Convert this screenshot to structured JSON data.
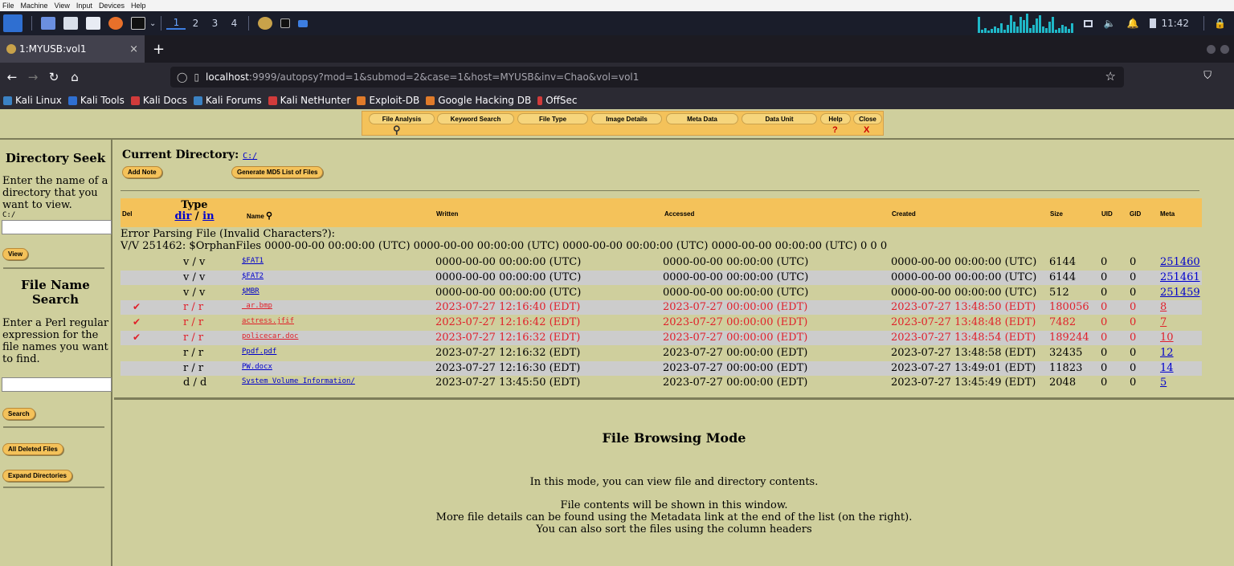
{
  "vm_menu": [
    "File",
    "Machine",
    "View",
    "Input",
    "Devices",
    "Help"
  ],
  "taskbar": {
    "workspaces": [
      "1",
      "2",
      "3",
      "4"
    ],
    "active_workspace": "1",
    "clock": "11:42",
    "accent": "#3d7ee0"
  },
  "browser": {
    "tab_title": "1:MYUSB:vol1",
    "tab_close": "×",
    "new_tab": "+",
    "url_host": "localhost",
    "url_rest": ":9999/autopsy?mod=1&submod=2&case=1&host=MYUSB&inv=Chao&vol=vol1",
    "bookmarks": [
      {
        "label": "Kali Linux",
        "color": "#3b82c4"
      },
      {
        "label": "Kali Tools",
        "color": "#2f6fd1"
      },
      {
        "label": "Kali Docs",
        "color": "#d13b3b"
      },
      {
        "label": "Kali Forums",
        "color": "#3b82c4"
      },
      {
        "label": "Kali NetHunter",
        "color": "#d13b3b"
      },
      {
        "label": "Exploit-DB",
        "color": "#e07b2a"
      },
      {
        "label": "Google Hacking DB",
        "color": "#e07b2a"
      },
      {
        "label": "OffSec",
        "color": "#d13b3b"
      }
    ]
  },
  "autopsy_toolbar": {
    "tabs": [
      "File Analysis",
      "Keyword Search",
      "File Type",
      "Image Details",
      "Meta Data",
      "Data Unit",
      "Help",
      "Close"
    ],
    "help_glyph": "?",
    "close_glyph": "X"
  },
  "left_panel": {
    "dir_seek_title": "Directory Seek",
    "dir_seek_text": "Enter the name of a directory that you want to view.",
    "dir_seek_example": "C:/",
    "view_button": "View",
    "file_search_title": "File Name Search",
    "file_search_text": "Enter a Perl regular expression for the file names you want to find.",
    "search_button": "Search",
    "all_deleted_button": "All Deleted Files",
    "expand_dirs_button": "Expand Directories"
  },
  "main": {
    "current_dir_label": "Current Directory:",
    "current_dir": "C:/",
    "add_note_button": "Add Note",
    "md5_button": "Generate MD5 List of Files",
    "headers": {
      "del": "Del",
      "type": "Type",
      "type_dir": "dir",
      "type_sep": "/",
      "type_in": "in",
      "name": "Name",
      "written": "Written",
      "accessed": "Accessed",
      "created": "Created",
      "size": "Size",
      "uid": "UID",
      "gid": "GID",
      "meta": "Meta"
    },
    "error_line1": "Error Parsing File (Invalid Characters?):",
    "error_line2": "V/V 251462: $OrphanFiles 0000-00-00 00:00:00 (UTC) 0000-00-00 00:00:00 (UTC) 0000-00-00 00:00:00 (UTC) 0000-00-00 00:00:00 (UTC) 0 0 0",
    "rows": [
      {
        "deleted": false,
        "check": "",
        "type": "v / v",
        "name": "$FAT1",
        "written": "0000-00-00 00:00:00 (UTC)",
        "accessed": "0000-00-00 00:00:00 (UTC)",
        "created": "0000-00-00 00:00:00 (UTC)",
        "size": "6144",
        "uid": "0",
        "gid": "0",
        "meta": "251460"
      },
      {
        "deleted": false,
        "check": "",
        "type": "v / v",
        "name": "$FAT2",
        "written": "0000-00-00 00:00:00 (UTC)",
        "accessed": "0000-00-00 00:00:00 (UTC)",
        "created": "0000-00-00 00:00:00 (UTC)",
        "size": "6144",
        "uid": "0",
        "gid": "0",
        "meta": "251461"
      },
      {
        "deleted": false,
        "check": "",
        "type": "v / v",
        "name": "$MBR",
        "written": "0000-00-00 00:00:00 (UTC)",
        "accessed": "0000-00-00 00:00:00 (UTC)",
        "created": "0000-00-00 00:00:00 (UTC)",
        "size": "512",
        "uid": "0",
        "gid": "0",
        "meta": "251459"
      },
      {
        "deleted": true,
        "check": "✔",
        "type": "r / r",
        "name": "_ar.bmp",
        "written": "2023-07-27 12:16:40 (EDT)",
        "accessed": "2023-07-27 00:00:00 (EDT)",
        "created": "2023-07-27 13:48:50 (EDT)",
        "size": "180056",
        "uid": "0",
        "gid": "0",
        "meta": "8"
      },
      {
        "deleted": true,
        "check": "✔",
        "type": "r / r",
        "name": "actress.jfif",
        "written": "2023-07-27 12:16:42 (EDT)",
        "accessed": "2023-07-27 00:00:00 (EDT)",
        "created": "2023-07-27 13:48:48 (EDT)",
        "size": "7482",
        "uid": "0",
        "gid": "0",
        "meta": "7"
      },
      {
        "deleted": true,
        "check": "✔",
        "type": "r / r",
        "name": "policecar.doc",
        "written": "2023-07-27 12:16:32 (EDT)",
        "accessed": "2023-07-27 00:00:00 (EDT)",
        "created": "2023-07-27 13:48:54 (EDT)",
        "size": "189244",
        "uid": "0",
        "gid": "0",
        "meta": "10"
      },
      {
        "deleted": false,
        "check": "",
        "type": "r / r",
        "name": "Ppdf.pdf",
        "written": "2023-07-27 12:16:32 (EDT)",
        "accessed": "2023-07-27 00:00:00 (EDT)",
        "created": "2023-07-27 13:48:58 (EDT)",
        "size": "32435",
        "uid": "0",
        "gid": "0",
        "meta": "12"
      },
      {
        "deleted": false,
        "check": "",
        "type": "r / r",
        "name": "PW.docx",
        "written": "2023-07-27 12:16:30 (EDT)",
        "accessed": "2023-07-27 00:00:00 (EDT)",
        "created": "2023-07-27 13:49:01 (EDT)",
        "size": "11823",
        "uid": "0",
        "gid": "0",
        "meta": "14"
      },
      {
        "deleted": false,
        "check": "",
        "type": "d / d",
        "name": "System Volume Information/",
        "written": "2023-07-27 13:45:50 (EDT)",
        "accessed": "2023-07-27 00:00:00 (EDT)",
        "created": "2023-07-27 13:45:49 (EDT)",
        "size": "2048",
        "uid": "0",
        "gid": "0",
        "meta": "5"
      }
    ]
  },
  "bottom": {
    "title": "File Browsing Mode",
    "line1": "In this mode, you can view file and directory contents.",
    "line2": "File contents will be shown in this window.",
    "line3": "More file details can be found using the Metadata link at the end of the list (on the right).",
    "line4": "You can also sort the files using the column headers"
  },
  "colors": {
    "background": "#cfcf9d",
    "header_bg": "#f4c25a",
    "deleted_text": "#e0202a",
    "link": "#0000cc"
  }
}
